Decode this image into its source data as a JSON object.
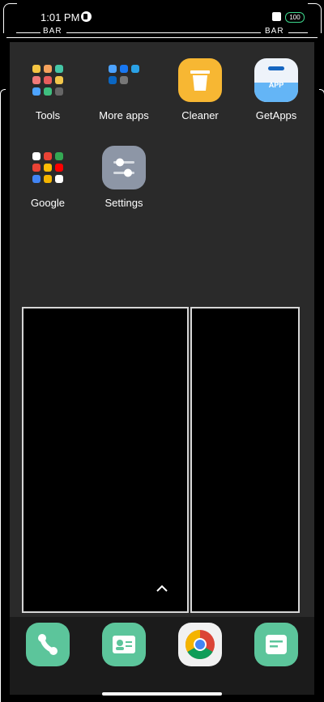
{
  "status_bar": {
    "time": "1:01 PM",
    "battery": "100"
  },
  "frame": {
    "bar_left": "BAR",
    "bar_right": "BAR"
  },
  "apps": [
    {
      "label": "Tools"
    },
    {
      "label": "More apps"
    },
    {
      "label": "Cleaner"
    },
    {
      "label": "GetApps",
      "badge": "APP"
    },
    {
      "label": "Google"
    },
    {
      "label": "Settings"
    }
  ],
  "dock": [
    {
      "name": "phone-icon"
    },
    {
      "name": "contacts-icon"
    },
    {
      "name": "chrome-icon"
    },
    {
      "name": "messages-icon"
    }
  ],
  "colors": {
    "panel": "#2a2a2a",
    "dock_green": "#5cc59b",
    "cleaner": "#f7b733",
    "settings": "#8d96a6",
    "battery_ring": "#3dd68c"
  }
}
